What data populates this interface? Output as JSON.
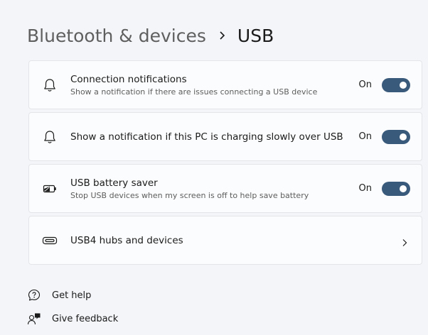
{
  "breadcrumb": {
    "parent": "Bluetooth & devices",
    "current": "USB"
  },
  "settings": [
    {
      "title": "Connection notifications",
      "subtitle": "Show a notification if there are issues connecting a USB device",
      "state": "On",
      "icon": "bell-icon"
    },
    {
      "title": "Show a notification if this PC is charging slowly over USB",
      "state": "On",
      "icon": "bell-icon"
    },
    {
      "title": "USB battery saver",
      "subtitle": "Stop USB devices when my screen is off to help save battery",
      "state": "On",
      "icon": "battery-saver-icon"
    },
    {
      "title": "USB4 hubs and devices",
      "icon": "usb-port-icon"
    }
  ],
  "links": {
    "help": "Get help",
    "feedback": "Give feedback"
  },
  "colors": {
    "toggle_on": "#3a5a7b",
    "page_background": "#f3f5f9",
    "card_background": "#fbfcfd"
  }
}
